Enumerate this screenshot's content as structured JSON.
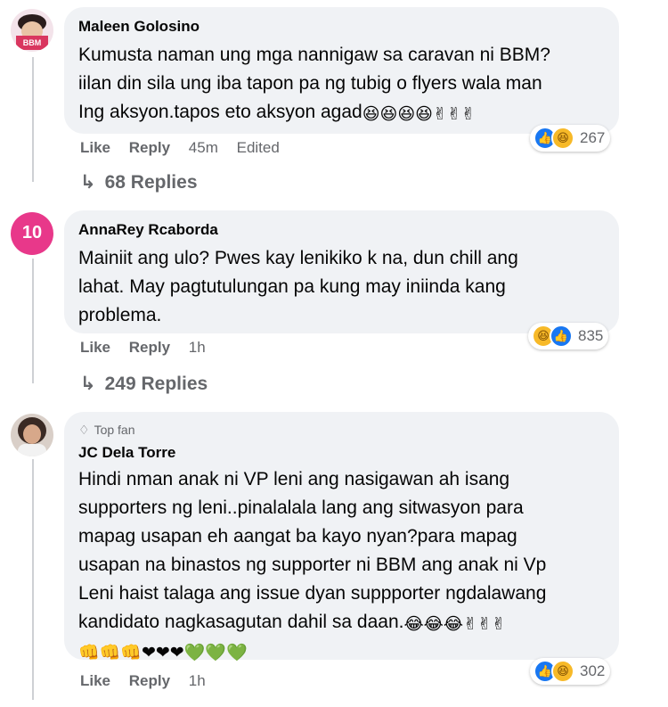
{
  "comments": [
    {
      "author": "Maleen Golosino",
      "text": "Kumusta naman ung mga nannigaw sa caravan ni BBM?\niilan din sila ung iba tapon pa ng tubig o flyers wala man\nIng aksyon.tapos eto aksyon agad",
      "emojis": "😆😆😆😆✌✌✌",
      "like": "Like",
      "reply": "Reply",
      "time": "45m",
      "edited": "Edited",
      "reaction_count": "267",
      "replies": "68 Replies",
      "avatar_badge": "BBM"
    },
    {
      "author": "AnnaRey Rcaborda",
      "text": "Mainiit ang ulo? Pwes kay lenikiko k na, dun chill ang\nlahat. May pagtutulungan pa kung may iniinda kang\nproblema.",
      "like": "Like",
      "reply": "Reply",
      "time": "1h",
      "reaction_count": "835",
      "replies": "249 Replies",
      "avatar_badge": "10"
    },
    {
      "badge": "Top fan",
      "author": "JC Dela Torre",
      "text": "Hindi nman anak ni VP leni ang nasigawan ah isang\nsupporters ng leni..pinalalala lang ang sitwasyon para\nmapag usapan eh aangat ba kayo nyan?para mapag\nusapan na binastos ng supporter ni BBM ang anak ni Vp\nLeni haist talaga ang issue dyan suppporter ngdalawang\nkandidato nagkasagutan dahil sa daan.",
      "emojis": "😂😂😂✌✌✌",
      "emojis2": "👊👊👊❤❤❤💚💚💚",
      "like": "Like",
      "reply": "Reply",
      "time": "1h",
      "reaction_count": "302"
    }
  ],
  "icons": {
    "replies_arrow": "reply-arrow-icon",
    "like_reaction": "like-reaction-icon",
    "haha_reaction": "haha-reaction-icon",
    "top_fan": "diamond-icon"
  },
  "colors": {
    "bubble": "#f0f2f5",
    "like_blue": "#1877f2",
    "haha_yellow": "#f7b928",
    "meta_gray": "#65676b",
    "avatar2_pink": "#e8388a"
  }
}
